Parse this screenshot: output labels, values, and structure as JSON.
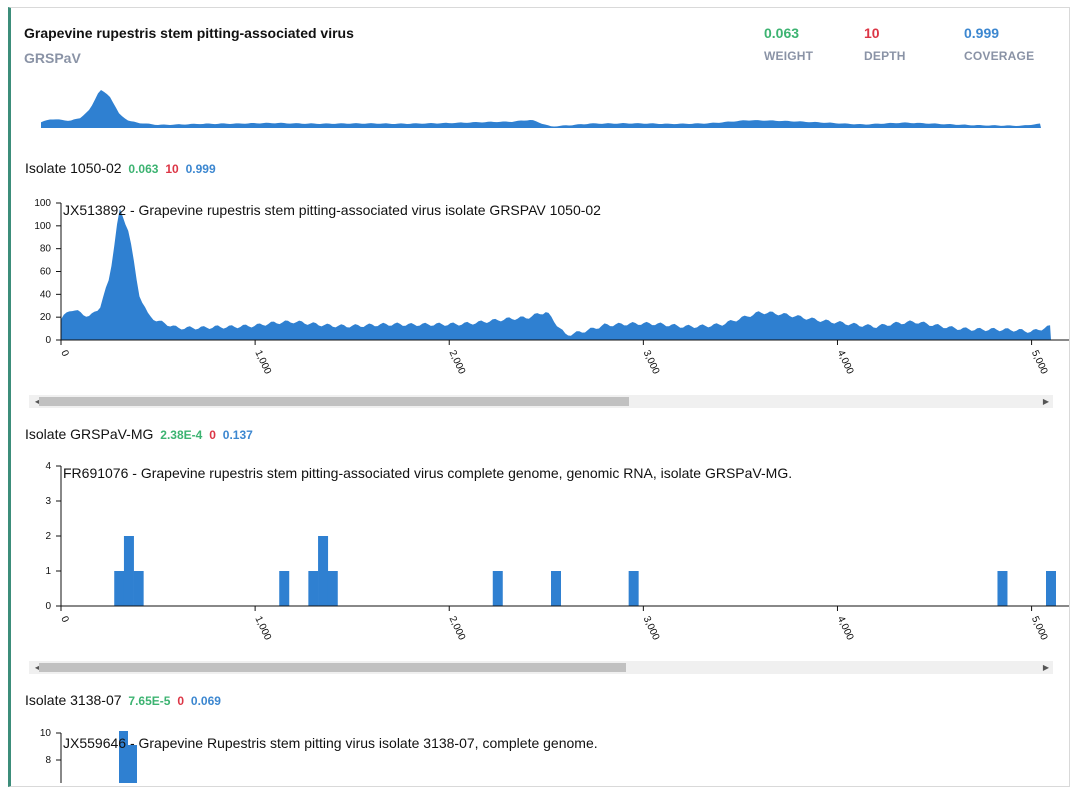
{
  "virus": {
    "name": "Grapevine rupestris stem pitting-associated virus",
    "abbreviation": "GRSPaV",
    "stats": [
      {
        "value": "0.063",
        "label": "WEIGHT",
        "color": "#3cb371"
      },
      {
        "value": "10",
        "label": "DEPTH",
        "color": "#dc3545"
      },
      {
        "value": "0.999",
        "label": "COVERAGE",
        "color": "#3c87d0"
      }
    ]
  },
  "isolates": [
    {
      "label": "Isolate 1050-02",
      "weight": "0.063",
      "depth": "10",
      "coverage": "0.999",
      "sequence_title": "JX513892 - Grapevine rupestris stem pitting-associated virus isolate GRSPAV 1050-02",
      "y_ticks": [
        "0",
        "20",
        "40",
        "60",
        "80",
        "100"
      ],
      "y_top_label": "100",
      "x_ticks": [
        "0",
        "1,000",
        "2,000",
        "3,000",
        "4,000",
        "5,000"
      ]
    },
    {
      "label": "Isolate GRSPaV-MG",
      "weight": "2.38E-4",
      "depth": "0",
      "coverage": "0.137",
      "sequence_title": "FR691076 - Grapevine rupestris stem pitting-associated virus complete genome, genomic RNA, isolate GRSPaV-MG.",
      "y_ticks": [
        "0",
        "1",
        "2",
        "3"
      ],
      "y_top_label": "4",
      "x_ticks": [
        "0",
        "1,000",
        "2,000",
        "3,000",
        "4,000",
        "5,000"
      ]
    },
    {
      "label": "Isolate 3138-07",
      "weight": "7.65E-5",
      "depth": "0",
      "coverage": "0.069",
      "sequence_title": "JX559646 - Grapevine Rupestris stem pitting virus isolate 3138-07, complete genome.",
      "y_ticks": [
        "8"
      ],
      "y_top_label": "10"
    }
  ],
  "chart_data": [
    {
      "type": "area",
      "title": "JX513892 - Grapevine rupestris stem pitting-associated virus isolate GRSPAV 1050-02",
      "xlim": [
        0,
        5100
      ],
      "ylim": [
        0,
        120
      ],
      "x": [
        0,
        50,
        100,
        150,
        200,
        250,
        300,
        350,
        400,
        450,
        500,
        600,
        800,
        1000,
        1200,
        1400,
        1600,
        1800,
        2000,
        2200,
        2400,
        2500,
        2600,
        2800,
        3000,
        3200,
        3400,
        3600,
        3800,
        4000,
        4200,
        4400,
        4600,
        4800,
        5000,
        5100
      ],
      "y": [
        18,
        28,
        25,
        22,
        30,
        55,
        115,
        95,
        40,
        20,
        15,
        10,
        13,
        12,
        15,
        14,
        13,
        12,
        15,
        17,
        18,
        24,
        5,
        14,
        13,
        12,
        15,
        23,
        20,
        17,
        11,
        15,
        12,
        9,
        6,
        12
      ]
    },
    {
      "type": "bar",
      "title": "FR691076 - Grapevine rupestris stem pitting-associated virus complete genome, genomic RNA, isolate GRSPaV-MG.",
      "xlim": [
        0,
        5100
      ],
      "ylim": [
        0,
        4
      ],
      "x": [
        300,
        350,
        400,
        1150,
        1300,
        1350,
        1400,
        2250,
        2550,
        2950,
        4850,
        5100
      ],
      "y": [
        1,
        2,
        1,
        1,
        1,
        2,
        1,
        1,
        1,
        1,
        1,
        1
      ]
    }
  ]
}
